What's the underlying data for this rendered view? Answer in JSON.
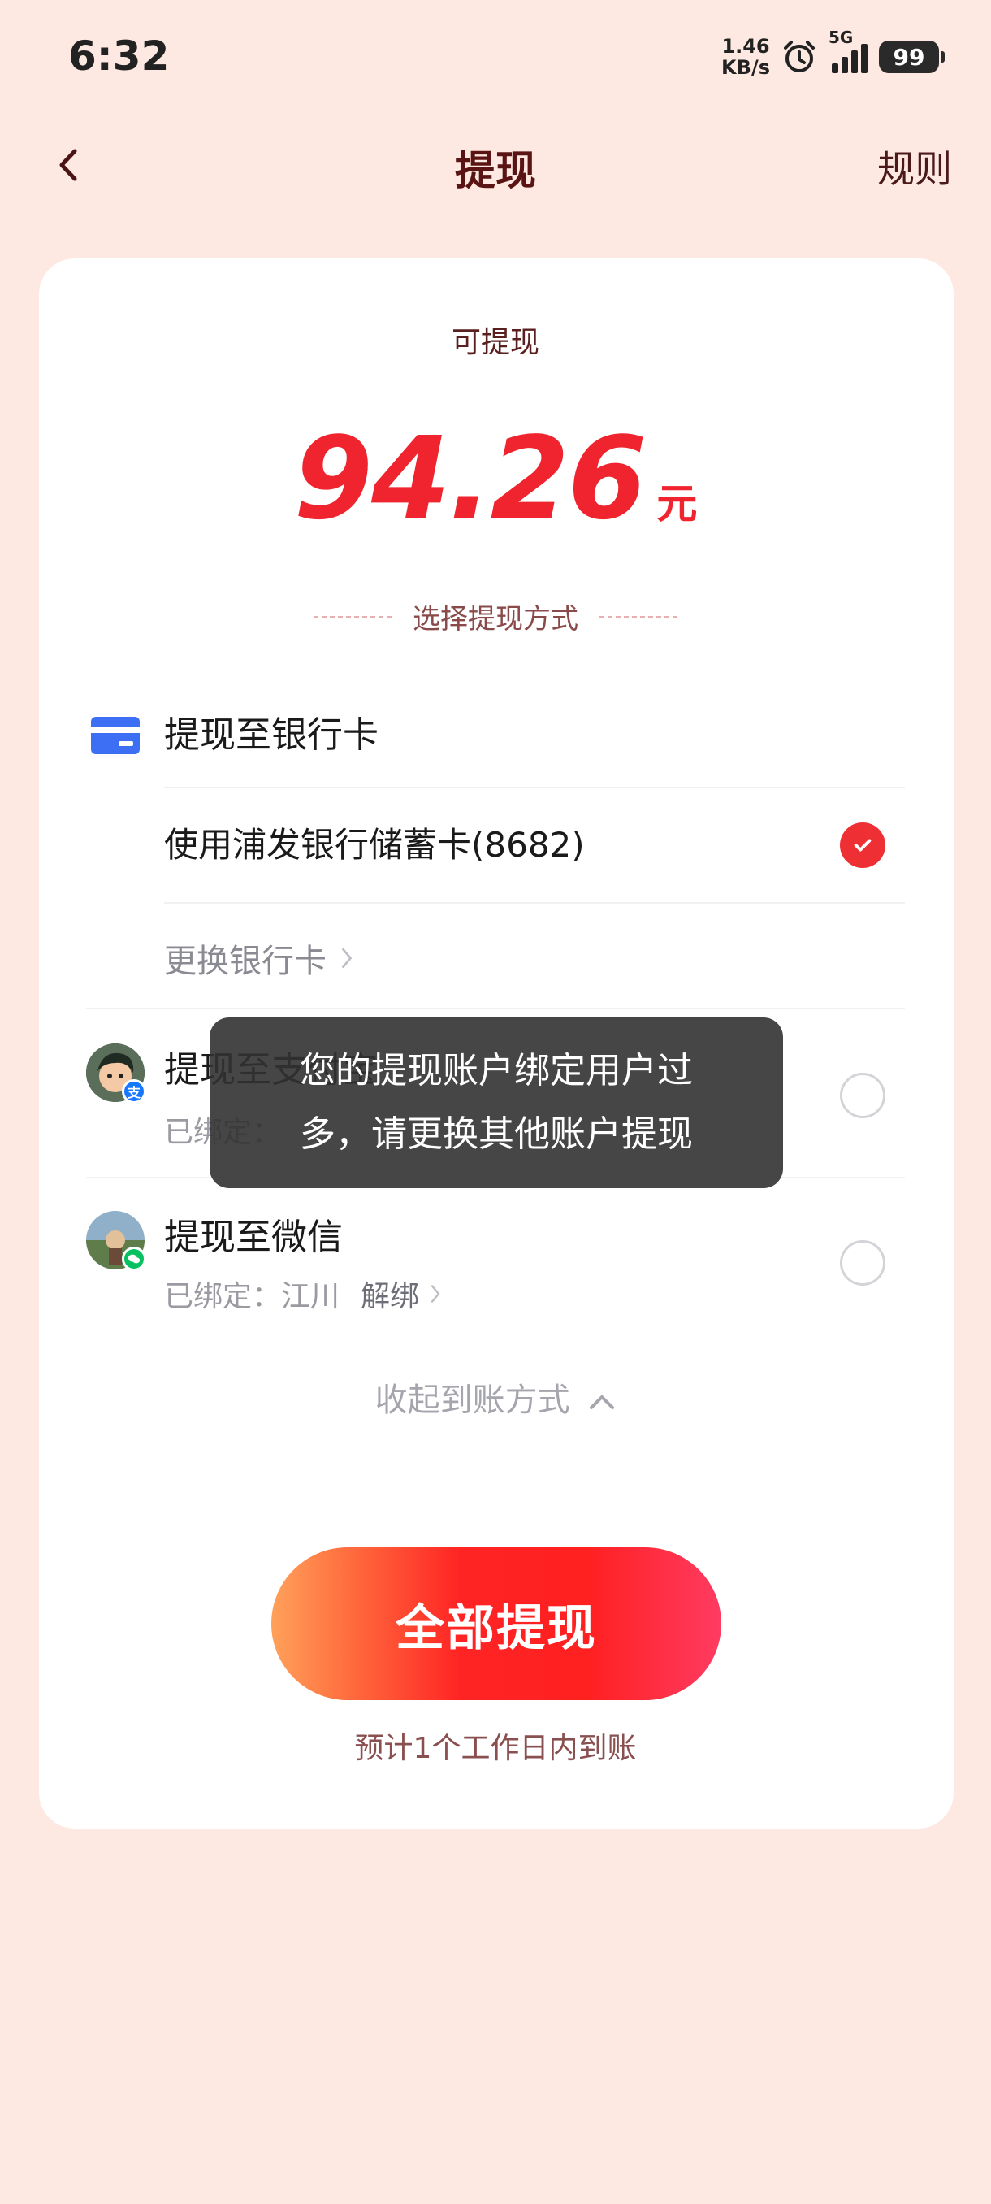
{
  "status_bar": {
    "time": "6:32",
    "net_speed_value": "1.46",
    "net_speed_unit": "KB/s",
    "network": "5G",
    "battery": "99"
  },
  "nav": {
    "title": "提现",
    "rules_label": "规则"
  },
  "balance": {
    "label": "可提现",
    "amount": "94.26",
    "unit": "元"
  },
  "method_header": "选择提现方式",
  "bank": {
    "title": "提现至银行卡",
    "card_label": "使用浦发银行储蓄卡(8682)",
    "change_label": "更换银行卡",
    "selected": true
  },
  "alipay": {
    "title": "提现至支付宝",
    "bound_label": "已绑定：",
    "bound_name": "",
    "selected": false
  },
  "wechat": {
    "title": "提现至微信",
    "bound_label": "已绑定：",
    "bound_name": "江川",
    "unbind_label": "解绑",
    "selected": false
  },
  "collapse_label": "收起到账方式",
  "withdraw_button": "全部提现",
  "eta_note": "预计1个工作日内到账",
  "toast": {
    "line1": "您的提现账户绑定用户过",
    "line2": "多，请更换其他账户提现"
  },
  "colors": {
    "page_bg": "#fde9e1",
    "accent_red": "#f0242e",
    "title_brown": "#5a1414",
    "toast_bg": "#323232"
  }
}
